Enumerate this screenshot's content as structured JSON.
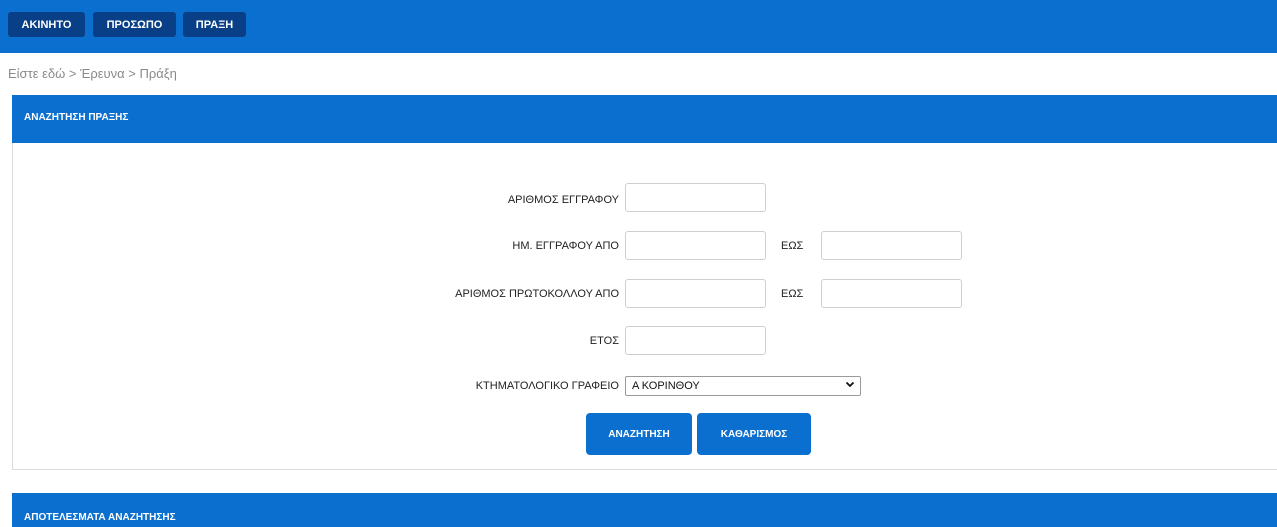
{
  "topnav": {
    "items": [
      {
        "label": "ΑΚΙΝΗΤΟ"
      },
      {
        "label": "ΠΡΟΣΩΠΟ"
      },
      {
        "label": "ΠΡΑΞΗ"
      }
    ]
  },
  "breadcrumb": "Είστε εδώ > Έρευνα > Πράξη",
  "search_panel": {
    "title": "ΑΝΑΖΗΤΗΣΗ ΠΡΑΞΗΣ",
    "doc_number_label": "ΑΡΙΘΜΟΣ ΕΓΓΡΑΦΟΥ",
    "doc_date_from_label": "ΗΜ. ΕΓΓΡΑΦΟΥ ΑΠΟ",
    "doc_date_to_label": "ΕΩΣ",
    "protocol_from_label": "ΑΡΙΘΜΟΣ ΠΡΩΤΟΚΟΛΛΟΥ ΑΠΟ",
    "protocol_to_label": "ΕΩΣ",
    "year_label": "ΕΤΟΣ",
    "office_label": "ΚΤΗΜΑΤΟΛΟΓΙΚΟ ΓΡΑΦΕΙΟ",
    "office_selected": "Α ΚΟΡΙΝΘΟΥ",
    "doc_number_value": "",
    "doc_date_from_value": "",
    "doc_date_to_value": "",
    "protocol_from_value": "",
    "protocol_to_value": "",
    "year_value": "",
    "search_button": "ΑΝΑΖΗΤΗΣΗ",
    "clear_button": "ΚΑΘΑΡΙΣΜΟΣ"
  },
  "results_panel": {
    "title": "ΑΠΟΤΕΛΕΣΜΑΤΑ ΑΝΑΖΗΤΗΣΗΣ"
  },
  "colors": {
    "primary": "#0b6fd0",
    "nav_button": "#083f86"
  }
}
